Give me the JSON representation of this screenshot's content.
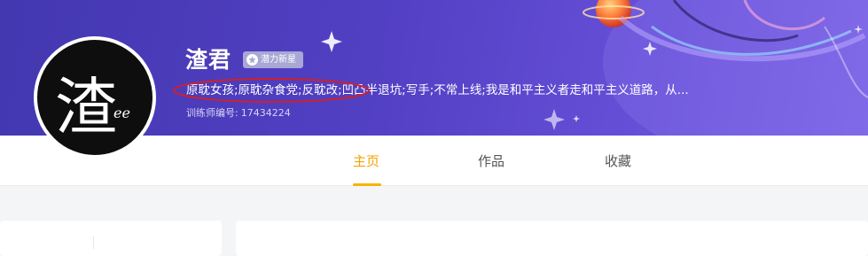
{
  "profile": {
    "username": "渣君",
    "badge_label": "潜力新星",
    "bio": "原耽女孩;原耽杂食党;反耽改;凹凸半退坑;写手;不常上线;我是和平主义者走和平主义道路，从...",
    "trainer_id_label": "训练师编号:",
    "trainer_id_value": "17434224"
  },
  "avatar": {
    "glyph": "渣",
    "suffix": "ee"
  },
  "tabs": [
    {
      "label": "主页",
      "active": true
    },
    {
      "label": "作品",
      "active": false
    },
    {
      "label": "收藏",
      "active": false
    }
  ],
  "colors": {
    "accent": "#f5a300",
    "banner_start": "#4338b0",
    "banner_end": "#7d66e6",
    "annotation": "#d0202a"
  }
}
